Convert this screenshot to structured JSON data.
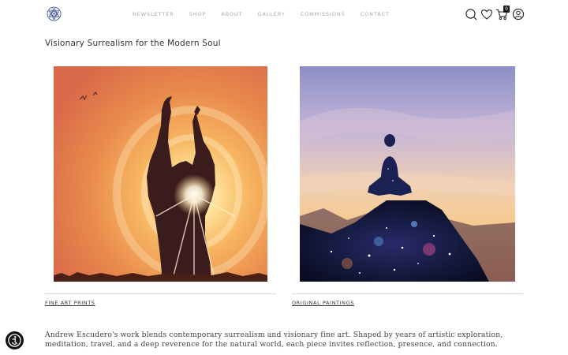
{
  "header": {
    "logo_icon": "mandala-logo-icon",
    "nav": [
      {
        "label": "NEWSLETTER"
      },
      {
        "label": "SHOP"
      },
      {
        "label": "ABOUT"
      },
      {
        "label": "GALLERY"
      },
      {
        "label": "COMMISSIONS"
      },
      {
        "label": "CONTACT"
      }
    ],
    "icons": [
      "search-icon",
      "heart-icon",
      "cart-icon",
      "account-icon"
    ],
    "cart_count": "0"
  },
  "main": {
    "title": "Visionary Surrealism for the Modern Soul",
    "cards": [
      {
        "link": "FINE ART PRINTS",
        "image": "woman-silhouette-sun-painting"
      },
      {
        "link": "ORIGINAL PAINTINGS",
        "image": "meditating-figure-cosmos-painting"
      }
    ],
    "intro": "Andrew Escudero's work blends contemporary surrealism and visionary fine art. Shaped by years of artistic exploration, meditation, travel, and a deep reverence for the natural world, each piece invites reflection, presence, and connection."
  },
  "accessibility": {
    "icon": "accessibility-icon"
  },
  "colors": {
    "accent": "#1a1a1a",
    "nav_text": "#a8a8a8"
  }
}
